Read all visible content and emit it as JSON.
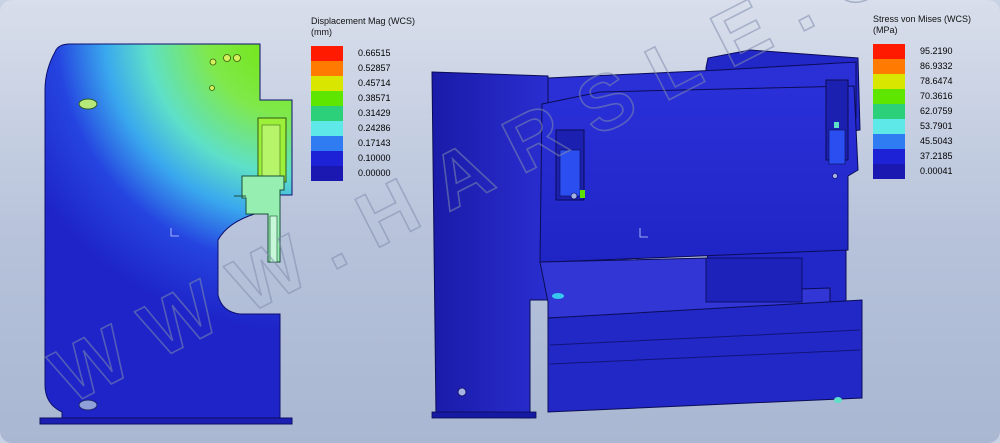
{
  "displacement_legend": {
    "title": "Displacement Mag (WCS)",
    "unit": "(mm)",
    "values": [
      "0.66515",
      "0.52857",
      "0.45714",
      "0.38571",
      "0.31429",
      "0.24286",
      "0.17143",
      "0.10000",
      "0.00000"
    ],
    "colors": [
      "#ff1a00",
      "#ff7a00",
      "#d8e600",
      "#5fe600",
      "#2cd07a",
      "#5fe8e8",
      "#2f7cf2",
      "#1e22d6",
      "#1a18b0"
    ]
  },
  "stress_legend": {
    "title": "Stress von Mises (WCS)",
    "unit": "(MPa)",
    "values": [
      "95.2190",
      "86.9332",
      "78.6474",
      "70.3616",
      "62.0759",
      "53.7901",
      "45.5043",
      "37.2185",
      "0.00041"
    ],
    "colors": [
      "#ff1a00",
      "#ff7a00",
      "#d8e600",
      "#5fe600",
      "#2cd07a",
      "#5fe8e8",
      "#2f7cf2",
      "#1e22d6",
      "#1a18b0"
    ]
  },
  "watermark": "WWW.HARSLE.COM"
}
